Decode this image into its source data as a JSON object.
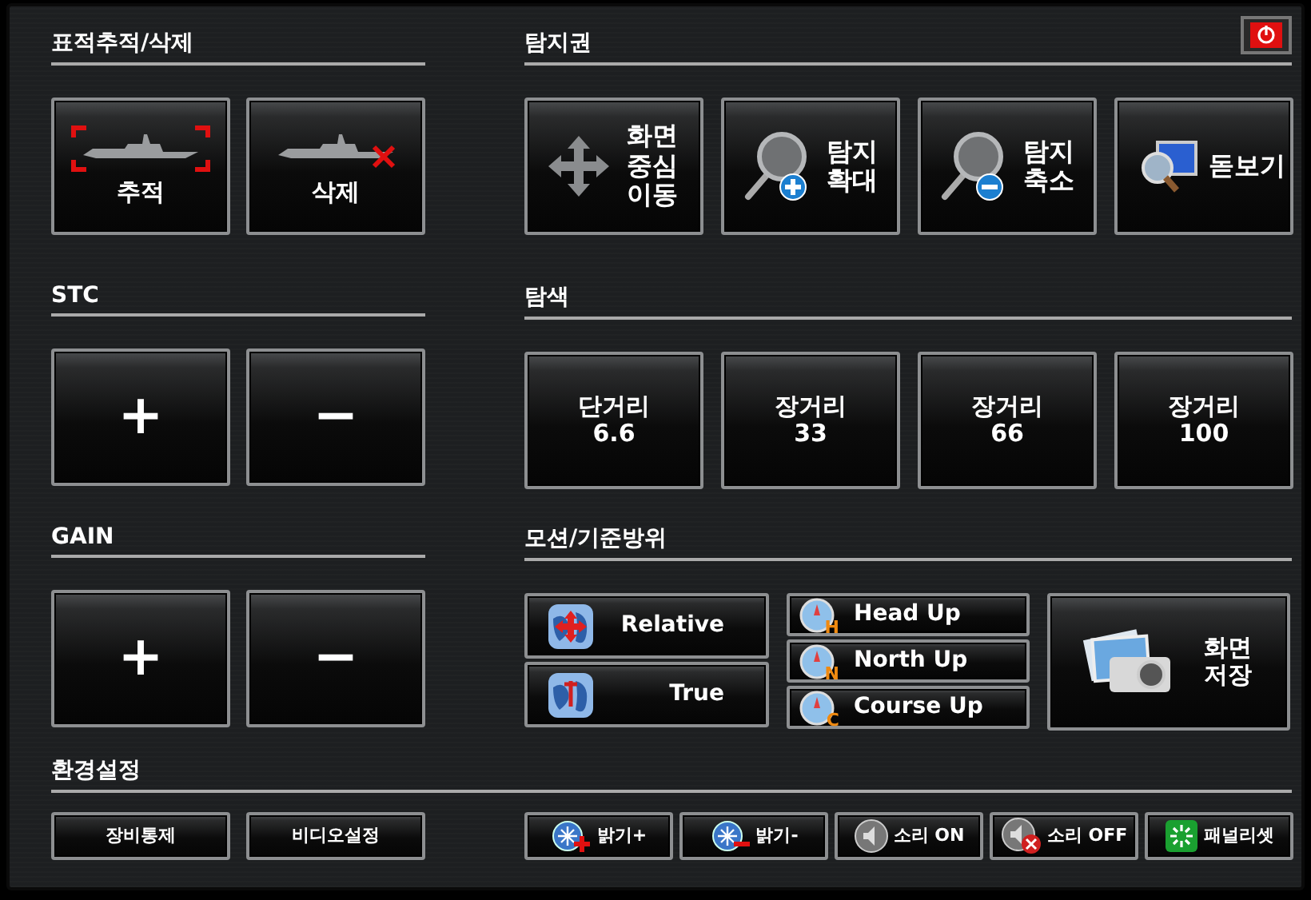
{
  "power_button": {
    "kind": "power"
  },
  "target": {
    "title": "표적추적/삭제",
    "buttons": [
      {
        "label": "추적",
        "kind": "ship-track"
      },
      {
        "label": "삭제",
        "kind": "ship-delete"
      }
    ]
  },
  "range": {
    "title": "탐지권",
    "buttons": [
      {
        "label": "화면 중심 이동",
        "kind": "move"
      },
      {
        "label": "탐지 확대",
        "kind": "zoom-in"
      },
      {
        "label": "탐지 축소",
        "kind": "zoom-out"
      },
      {
        "label": "돋보기",
        "kind": "magnifier"
      }
    ]
  },
  "stc": {
    "title": "STC",
    "buttons": [
      {
        "label": "+"
      },
      {
        "label": "−"
      }
    ]
  },
  "search": {
    "title": "탐색",
    "buttons": [
      {
        "label": "단거리 6.6"
      },
      {
        "label": "장거리 33"
      },
      {
        "label": "장거리 66"
      },
      {
        "label": "장거리 100"
      }
    ]
  },
  "gain": {
    "title": "GAIN",
    "buttons": [
      {
        "label": "+"
      },
      {
        "label": "−"
      }
    ]
  },
  "motion": {
    "title": "모션/기준방위",
    "motion_buttons": [
      {
        "label": "Relative",
        "kind": "globe-cross"
      },
      {
        "label": "True",
        "kind": "globe-pin"
      }
    ],
    "bearing_buttons": [
      {
        "label": "Head Up",
        "icon_letter": "H"
      },
      {
        "label": "North Up",
        "icon_letter": "N"
      },
      {
        "label": "Course Up",
        "icon_letter": "C"
      }
    ],
    "save_button": {
      "label": "화면 저장"
    }
  },
  "settings": {
    "title": "환경설정",
    "left_buttons": [
      {
        "label": "장비통제"
      },
      {
        "label": "비디오설정"
      }
    ],
    "right_buttons": [
      {
        "label": "밝기+",
        "kind": "bright-up"
      },
      {
        "label": "밝기-",
        "kind": "bright-down"
      },
      {
        "label": "소리 ON",
        "kind": "sound-on"
      },
      {
        "label": "소리 OFF",
        "kind": "sound-off"
      },
      {
        "label": "패널리셋",
        "kind": "reset"
      }
    ]
  }
}
